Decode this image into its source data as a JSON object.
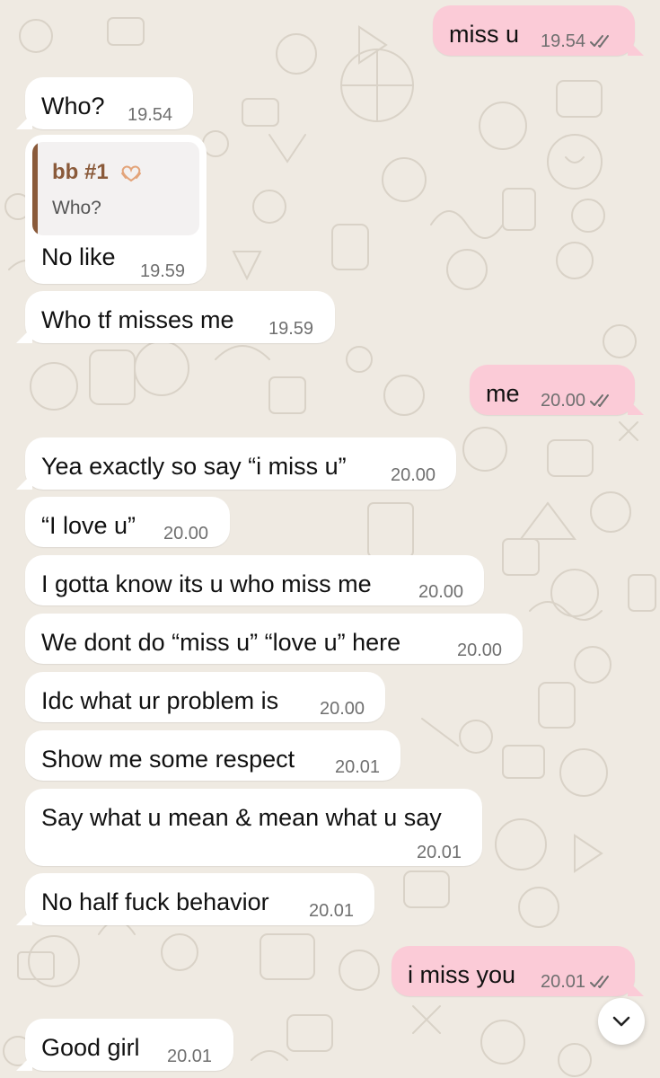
{
  "messages": [
    {
      "text": "miss u",
      "time": "19.54",
      "direction": "out",
      "status": "read"
    },
    {
      "text": "Who?",
      "time": "19.54",
      "direction": "in"
    },
    {
      "text": "No like",
      "time": "19.59",
      "direction": "in",
      "reply_to": {
        "name": "bb #1",
        "text": "Who?"
      }
    },
    {
      "text": "Who tf misses me",
      "time": "19.59",
      "direction": "in"
    },
    {
      "text": "me",
      "time": "20.00",
      "direction": "out",
      "status": "read"
    },
    {
      "text": "Yea exactly so say “i miss u”",
      "time": "20.00",
      "direction": "in"
    },
    {
      "text": "“I love u”",
      "time": "20.00",
      "direction": "in"
    },
    {
      "text": "I gotta know its u who miss me",
      "time": "20.00",
      "direction": "in"
    },
    {
      "text": "We dont do “miss u” “love u” here",
      "time": "20.00",
      "direction": "in"
    },
    {
      "text": "Idc what ur problem is",
      "time": "20.00",
      "direction": "in"
    },
    {
      "text": "Show me some respect",
      "time": "20.01",
      "direction": "in"
    },
    {
      "text": "Say what u mean & mean what u say",
      "time": "20.01",
      "direction": "in"
    },
    {
      "text": "No half fuck behavior",
      "time": "20.01",
      "direction": "in"
    },
    {
      "text": "i miss you",
      "time": "20.01",
      "direction": "out",
      "status": "read"
    },
    {
      "text": "Good girl",
      "time": "20.01",
      "direction": "in"
    }
  ],
  "scroll_button": {
    "icon": "chevron-down-icon"
  },
  "colors": {
    "background": "#efeae2",
    "incoming_bubble": "#ffffff",
    "outgoing_bubble": "#fbcbd7",
    "reply_accent": "#8a5a3a",
    "time_text": "#6f6f6f",
    "read_ticks": "#6f6f6f"
  }
}
